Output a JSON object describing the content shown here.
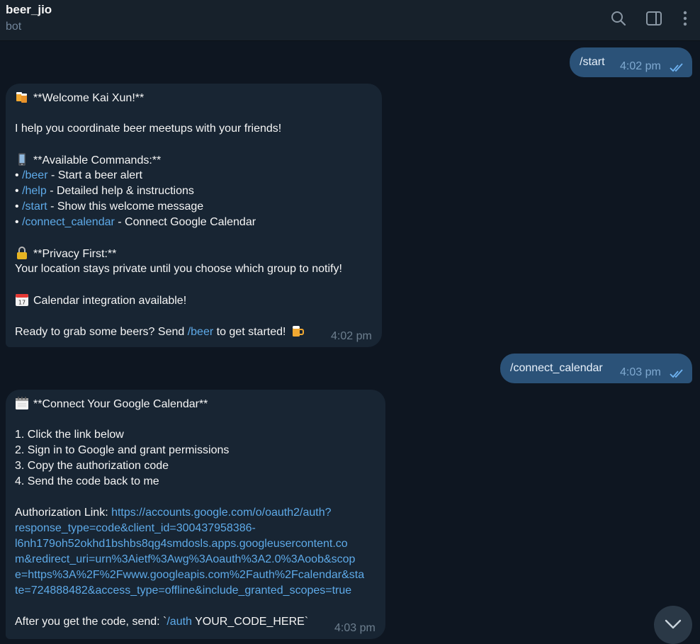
{
  "header": {
    "title": "beer_jio",
    "subtitle": "bot"
  },
  "icons": {
    "search": "search-icon",
    "sidebar": "sidebar-toggle-icon",
    "menu": "more-vertical-icon"
  },
  "messages": {
    "out1": {
      "text": "/start",
      "time": "4:02 pm"
    },
    "welcome": {
      "title": "**Welcome Kai Xun!**",
      "intro": "I help you coordinate beer meetups with your friends!",
      "commands_title": "**Available Commands:**",
      "bullet": "•",
      "cmd1": {
        "cmd": "/beer",
        "desc": " - Start a beer alert"
      },
      "cmd2": {
        "cmd": "/help",
        "desc": " - Detailed help & instructions"
      },
      "cmd3": {
        "cmd": "/start",
        "desc": " - Show this welcome message"
      },
      "cmd4": {
        "cmd": "/connect_calendar",
        "desc": " - Connect Google Calendar"
      },
      "privacy_title": "**Privacy First:**",
      "privacy_text": "Your location stays private until you choose which group to notify!",
      "calendar_text": "Calendar integration available!",
      "cta_pre": "Ready to grab some beers? Send ",
      "cta_cmd": "/beer",
      "cta_post": " to get started!",
      "time": "4:02 pm"
    },
    "out2": {
      "text": "/connect_calendar",
      "time": "4:03 pm"
    },
    "connect": {
      "title": "**Connect Your Google Calendar**",
      "step1": "1. Click the link below",
      "step2": "2. Sign in to Google and grant permissions",
      "step3": "3. Copy the authorization code",
      "step4": "4. Send the code back to me",
      "auth_label": "Authorization Link: ",
      "link1": "https://accounts.google.com/o/oauth2/auth?",
      "link2": "response_type=code&client_id=300437958386-",
      "link3": "l6nh179oh52okhd1bshbs8qg4smdosls.apps.googleusercontent.co",
      "link4": "m&redirect_uri=urn%3Aietf%3Awg%3Aoauth%3A2.0%3Aoob&scop",
      "link5": "e=https%3A%2F%2Fwww.googleapis.com%2Fauth%2Fcalendar&sta",
      "link6": "te=724888482&access_type=offline&include_granted_scopes=true",
      "after_pre": "After you get the code, send: `",
      "after_cmd": "/auth",
      "after_post": " YOUR_CODE_HERE`",
      "time": "4:03 pm"
    }
  }
}
